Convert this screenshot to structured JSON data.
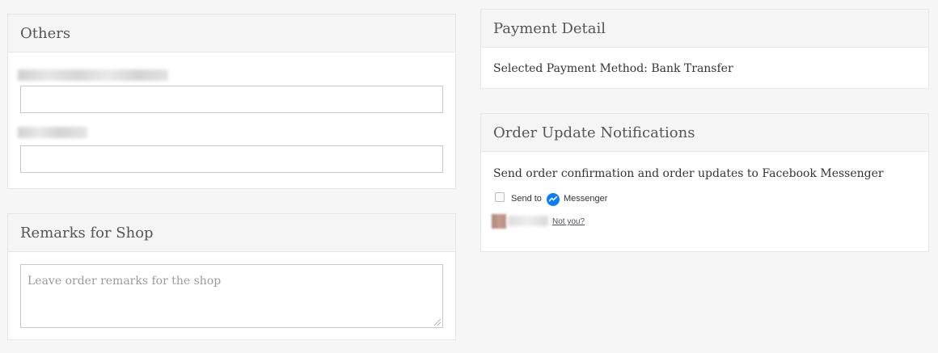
{
  "others": {
    "title": "Others",
    "field1_value": "",
    "field2_value": ""
  },
  "remarks": {
    "title": "Remarks for Shop",
    "placeholder": "Leave order remarks for the shop"
  },
  "payment": {
    "title": "Payment Detail",
    "method_text": "Selected Payment Method: Bank Transfer"
  },
  "notifications": {
    "title": "Order Update Notifications",
    "description": "Send order confirmation and order updates to Facebook Messenger",
    "send_to_label": "Send to",
    "messenger_label": "Messenger",
    "not_you_link": "Not you?",
    "icons": {
      "messenger": "messenger-icon"
    },
    "colors": {
      "messenger_blue": "#0a7cff"
    }
  }
}
